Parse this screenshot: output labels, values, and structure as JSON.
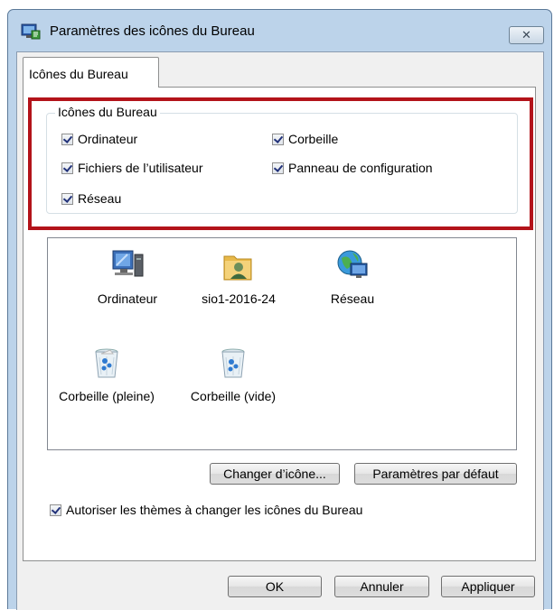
{
  "window": {
    "title": "Paramètres des icônes du Bureau",
    "close_glyph": "✕",
    "title_icon": "display-settings-icon"
  },
  "tabs": [
    {
      "label": "Icônes du Bureau",
      "selected": true
    }
  ],
  "group": {
    "legend": "Icônes du Bureau",
    "checkboxes": [
      {
        "label": "Ordinateur",
        "checked": true
      },
      {
        "label": "Corbeille",
        "checked": true
      },
      {
        "label": "Fichiers de l’utilisateur",
        "checked": true
      },
      {
        "label": "Panneau de configuration",
        "checked": true
      },
      {
        "label": "Réseau",
        "checked": true
      }
    ]
  },
  "icons": [
    {
      "label": "Ordinateur",
      "icon": "computer-icon"
    },
    {
      "label": "sio1-2016-24",
      "icon": "user-folder-icon"
    },
    {
      "label": "Réseau",
      "icon": "network-icon"
    },
    {
      "label": "Corbeille (pleine)",
      "icon": "recycle-bin-full-icon"
    },
    {
      "label": "Corbeille (vide)",
      "icon": "recycle-bin-empty-icon"
    }
  ],
  "buttons": {
    "change_icon": "Changer d’icône...",
    "default_settings": "Paramètres par défaut",
    "ok": "OK",
    "cancel": "Annuler",
    "apply": "Appliquer"
  },
  "themes_checkbox": {
    "label": "Autoriser les thèmes à changer les icônes du Bureau",
    "checked": true
  },
  "colors": {
    "highlight": "#b3131a",
    "accent_title": "#bcd3ea"
  }
}
